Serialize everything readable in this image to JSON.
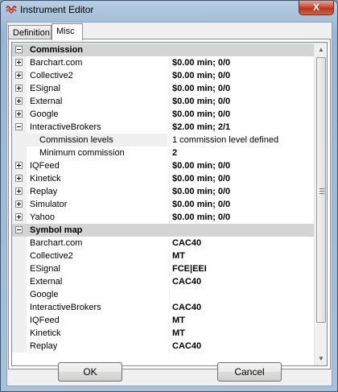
{
  "window": {
    "title": "Instrument Editor",
    "close_glyph": "X"
  },
  "tabs": [
    {
      "label": "Definition",
      "active": false
    },
    {
      "label": "Misc",
      "active": true
    }
  ],
  "grid": {
    "rows": [
      {
        "kind": "category",
        "expander": "minus",
        "name": "Commission",
        "value": ""
      },
      {
        "kind": "item",
        "expander": "plus",
        "name": "Barchart.com",
        "value": "$0.00 min;  0/0",
        "bold": true
      },
      {
        "kind": "item",
        "expander": "plus",
        "name": "Collective2",
        "value": "$0.00 min;  0/0",
        "bold": true
      },
      {
        "kind": "item",
        "expander": "plus",
        "name": "ESignal",
        "value": "$0.00 min;  0/0",
        "bold": true
      },
      {
        "kind": "item",
        "expander": "plus",
        "name": "External",
        "value": "$0.00 min;  0/0",
        "bold": true
      },
      {
        "kind": "item",
        "expander": "plus",
        "name": "Google",
        "value": "$0.00 min;  0/0",
        "bold": true
      },
      {
        "kind": "item",
        "expander": "minus",
        "name": "InteractiveBrokers",
        "value": "$2.00 min;  2/1",
        "bold": true
      },
      {
        "kind": "child",
        "selected": true,
        "name": "Commission levels",
        "value": "1 commission level defined",
        "bold": false
      },
      {
        "kind": "child",
        "name": "Minimum commission",
        "value": "2",
        "bold": true
      },
      {
        "kind": "item",
        "expander": "plus",
        "name": "IQFeed",
        "value": "$0.00 min;  0/0",
        "bold": true
      },
      {
        "kind": "item",
        "expander": "plus",
        "name": "Kinetick",
        "value": "$0.00 min;  0/0",
        "bold": true
      },
      {
        "kind": "item",
        "expander": "plus",
        "name": "Replay",
        "value": "$0.00 min;  0/0",
        "bold": true
      },
      {
        "kind": "item",
        "expander": "plus",
        "name": "Simulator",
        "value": "$0.00 min;  0/0",
        "bold": true
      },
      {
        "kind": "item",
        "expander": "plus",
        "name": "Yahoo",
        "value": "$0.00 min;  0/0",
        "bold": true
      },
      {
        "kind": "category",
        "expander": "minus",
        "name": "Symbol map",
        "value": ""
      },
      {
        "kind": "item",
        "name": "Barchart.com",
        "value": "CAC40",
        "bold": true
      },
      {
        "kind": "item",
        "name": "Collective2",
        "value": "MT",
        "bold": true
      },
      {
        "kind": "item",
        "name": "ESignal",
        "value": "FCE|EEI",
        "bold": true
      },
      {
        "kind": "item",
        "name": "External",
        "value": "CAC40",
        "bold": true
      },
      {
        "kind": "item",
        "name": "Google",
        "value": "",
        "bold": true
      },
      {
        "kind": "item",
        "name": "InteractiveBrokers",
        "value": "CAC40",
        "bold": true
      },
      {
        "kind": "item",
        "name": "IQFeed",
        "value": "MT",
        "bold": true
      },
      {
        "kind": "item",
        "name": "Kinetick",
        "value": "MT",
        "bold": true
      },
      {
        "kind": "item",
        "name": "Replay",
        "value": "CAC40",
        "bold": true
      }
    ]
  },
  "buttons": {
    "ok": "OK",
    "cancel": "Cancel"
  },
  "colors": {
    "category_bg": "#d4d4d4",
    "gutter_bg": "#f0f0f0",
    "app_icon": "#c0392b"
  }
}
